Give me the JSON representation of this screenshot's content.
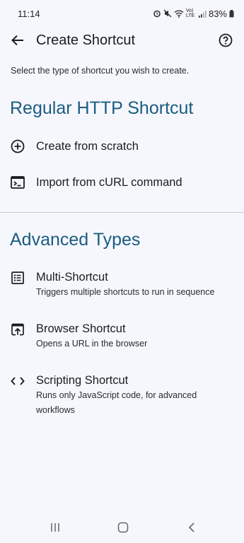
{
  "status": {
    "time": "11:14",
    "battery": "83%",
    "network": "Vo) LTE"
  },
  "app_bar": {
    "title": "Create Shortcut"
  },
  "intro": "Select the type of shortcut you wish to create.",
  "regular": {
    "title": "Regular HTTP Shortcut",
    "items": [
      {
        "label": "Create from scratch",
        "icon": "add-circle-icon"
      },
      {
        "label": "Import from cURL command",
        "icon": "terminal-icon"
      }
    ]
  },
  "advanced": {
    "title": "Advanced Types",
    "items": [
      {
        "label": "Multi-Shortcut",
        "desc": "Triggers multiple shortcuts to run in sequence",
        "icon": "list-icon"
      },
      {
        "label": "Browser Shortcut",
        "desc": "Opens a URL in the browser",
        "icon": "open-in-browser-icon"
      },
      {
        "label": "Scripting Shortcut",
        "desc": "Runs only JavaScript code, for advanced workflows",
        "icon": "code-icon"
      }
    ]
  },
  "colors": {
    "accent": "#1b5c82",
    "background": "#f6f7fc",
    "text": "#1b1c20"
  }
}
